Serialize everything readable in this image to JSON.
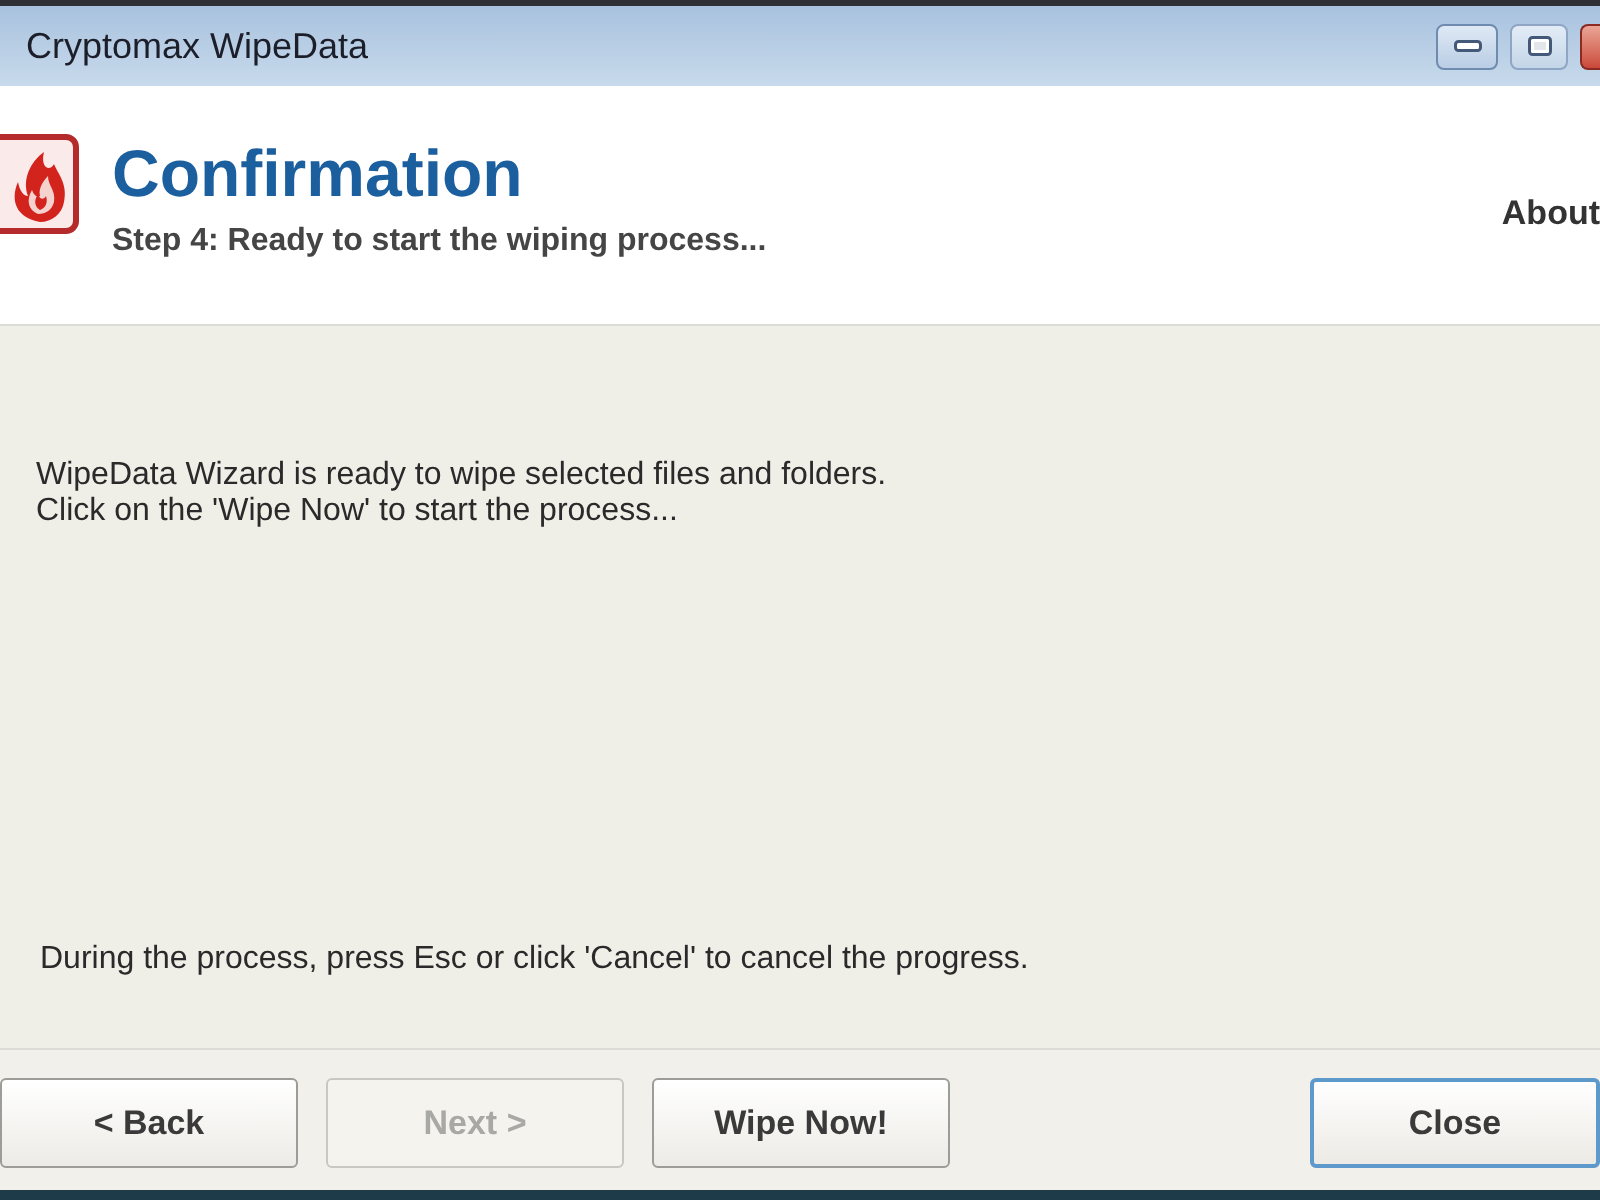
{
  "window": {
    "title": "Cryptomax WipeData"
  },
  "header": {
    "title": "Confirmation",
    "subtitle": "Step 4: Ready to start the wiping process...",
    "about_link": "About"
  },
  "body": {
    "lines": [
      "WipeData Wizard is ready to wipe selected files and folders.",
      "Click on the 'Wipe Now' to start the process..."
    ],
    "note": "During the process, press Esc or click 'Cancel' to cancel the progress."
  },
  "nav_buttons": [
    {
      "label": "< Back",
      "disabled": false
    },
    {
      "label": "Next >",
      "disabled": true
    },
    {
      "label": "Wipe Now!",
      "disabled": false
    }
  ],
  "close_button": {
    "label": "Close",
    "default": true
  }
}
